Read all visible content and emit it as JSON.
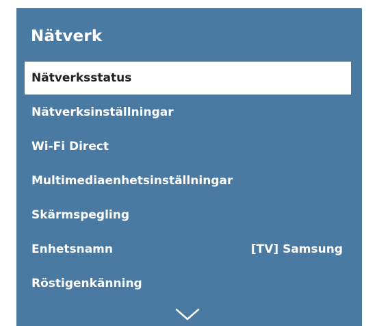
{
  "panel": {
    "title": "Nätverk"
  },
  "menu": {
    "items": [
      {
        "label": "Nätverksstatus",
        "selected": true
      },
      {
        "label": "Nätverksinställningar"
      },
      {
        "label": "Wi-Fi Direct"
      },
      {
        "label": "Multimediaenhetsinställningar"
      },
      {
        "label": "Skärmspegling"
      },
      {
        "label": "Enhetsnamn",
        "value": "[TV] Samsung"
      },
      {
        "label": "Röstigenkänning"
      }
    ]
  },
  "icons": {
    "scroll_down": "chevron-down-icon"
  },
  "colors": {
    "panel_background": "#4a79a2",
    "selected_background": "#ffffff",
    "text": "#ffffff",
    "selected_text": "#222222"
  }
}
